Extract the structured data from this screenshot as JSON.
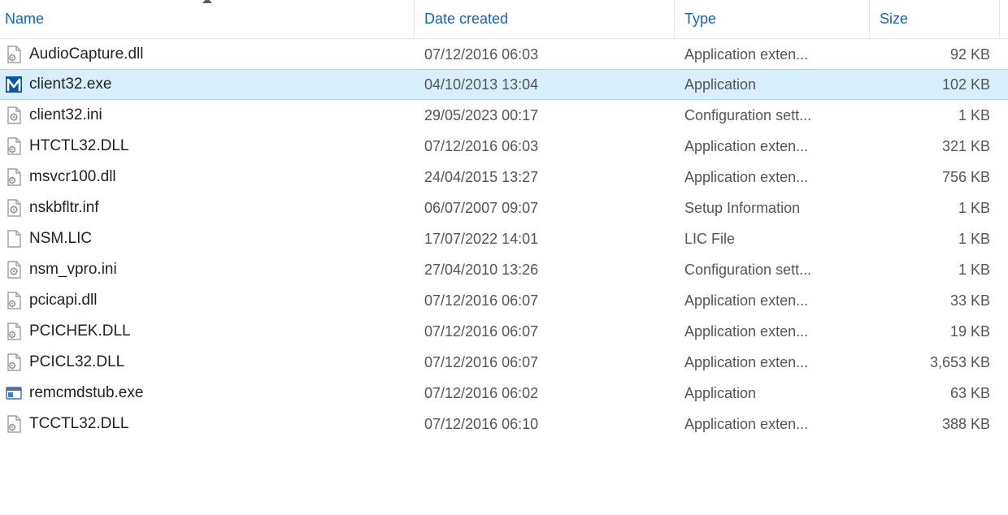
{
  "columns": {
    "name": "Name",
    "date": "Date created",
    "type": "Type",
    "size": "Size",
    "sorted_by": "name",
    "sort_dir": "asc"
  },
  "files": [
    {
      "icon": "dll",
      "name": "AudioCapture.dll",
      "date": "07/12/2016 06:03",
      "type": "Application exten...",
      "size": "92 KB",
      "selected": false
    },
    {
      "icon": "mexe",
      "name": "client32.exe",
      "date": "04/10/2013 13:04",
      "type": "Application",
      "size": "102 KB",
      "selected": true
    },
    {
      "icon": "ini",
      "name": "client32.ini",
      "date": "29/05/2023 00:17",
      "type": "Configuration sett...",
      "size": "1 KB",
      "selected": false
    },
    {
      "icon": "dll",
      "name": "HTCTL32.DLL",
      "date": "07/12/2016 06:03",
      "type": "Application exten...",
      "size": "321 KB",
      "selected": false
    },
    {
      "icon": "dll",
      "name": "msvcr100.dll",
      "date": "24/04/2015 13:27",
      "type": "Application exten...",
      "size": "756 KB",
      "selected": false
    },
    {
      "icon": "ini",
      "name": "nskbfltr.inf",
      "date": "06/07/2007 09:07",
      "type": "Setup Information",
      "size": "1 KB",
      "selected": false
    },
    {
      "icon": "file",
      "name": "NSM.LIC",
      "date": "17/07/2022 14:01",
      "type": "LIC File",
      "size": "1 KB",
      "selected": false
    },
    {
      "icon": "ini",
      "name": "nsm_vpro.ini",
      "date": "27/04/2010 13:26",
      "type": "Configuration sett...",
      "size": "1 KB",
      "selected": false
    },
    {
      "icon": "dll",
      "name": "pcicapi.dll",
      "date": "07/12/2016 06:07",
      "type": "Application exten...",
      "size": "33 KB",
      "selected": false
    },
    {
      "icon": "dll",
      "name": "PCICHEK.DLL",
      "date": "07/12/2016 06:07",
      "type": "Application exten...",
      "size": "19 KB",
      "selected": false
    },
    {
      "icon": "dll",
      "name": "PCICL32.DLL",
      "date": "07/12/2016 06:07",
      "type": "Application exten...",
      "size": "3,653 KB",
      "selected": false
    },
    {
      "icon": "exe",
      "name": "remcmdstub.exe",
      "date": "07/12/2016 06:02",
      "type": "Application",
      "size": "63 KB",
      "selected": false
    },
    {
      "icon": "dll",
      "name": "TCCTL32.DLL",
      "date": "07/12/2016 06:10",
      "type": "Application exten...",
      "size": "388 KB",
      "selected": false
    }
  ]
}
